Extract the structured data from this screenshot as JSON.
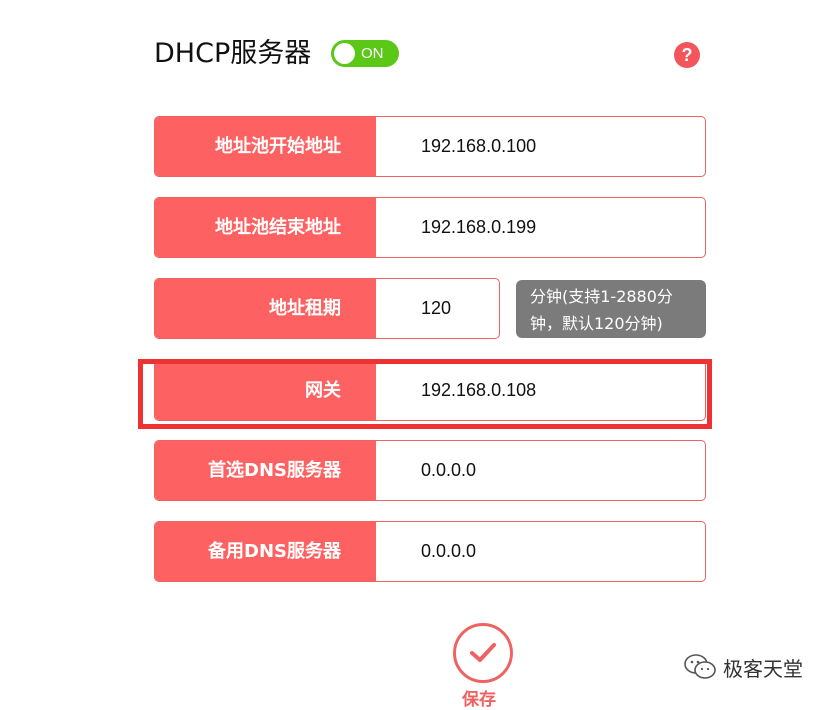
{
  "header": {
    "title": "DHCP服务器",
    "toggle_label": "ON",
    "help_symbol": "?"
  },
  "fields": [
    {
      "label": "地址池开始地址",
      "value": "192.168.0.100"
    },
    {
      "label": "地址池结束地址",
      "value": "192.168.0.199"
    },
    {
      "label": "地址租期",
      "value": "120"
    },
    {
      "label": "网关",
      "value": "192.168.0.108"
    },
    {
      "label": "首选DNS服务器",
      "value": "0.0.0.0"
    },
    {
      "label": "备用DNS服务器",
      "value": "0.0.0.0"
    }
  ],
  "lease_hint": {
    "line1": "分钟(支持1-2880分",
    "line2": "钟，默认120分钟)"
  },
  "footer": {
    "save_label": "保存"
  },
  "watermark": {
    "text": "极客天堂",
    "icon": "wechat-icon"
  },
  "colors": {
    "accent": "#fd6161",
    "toggle_on": "#5bc818",
    "highlight": "#ee3234",
    "tooltip_bg": "#7b7b7b"
  }
}
